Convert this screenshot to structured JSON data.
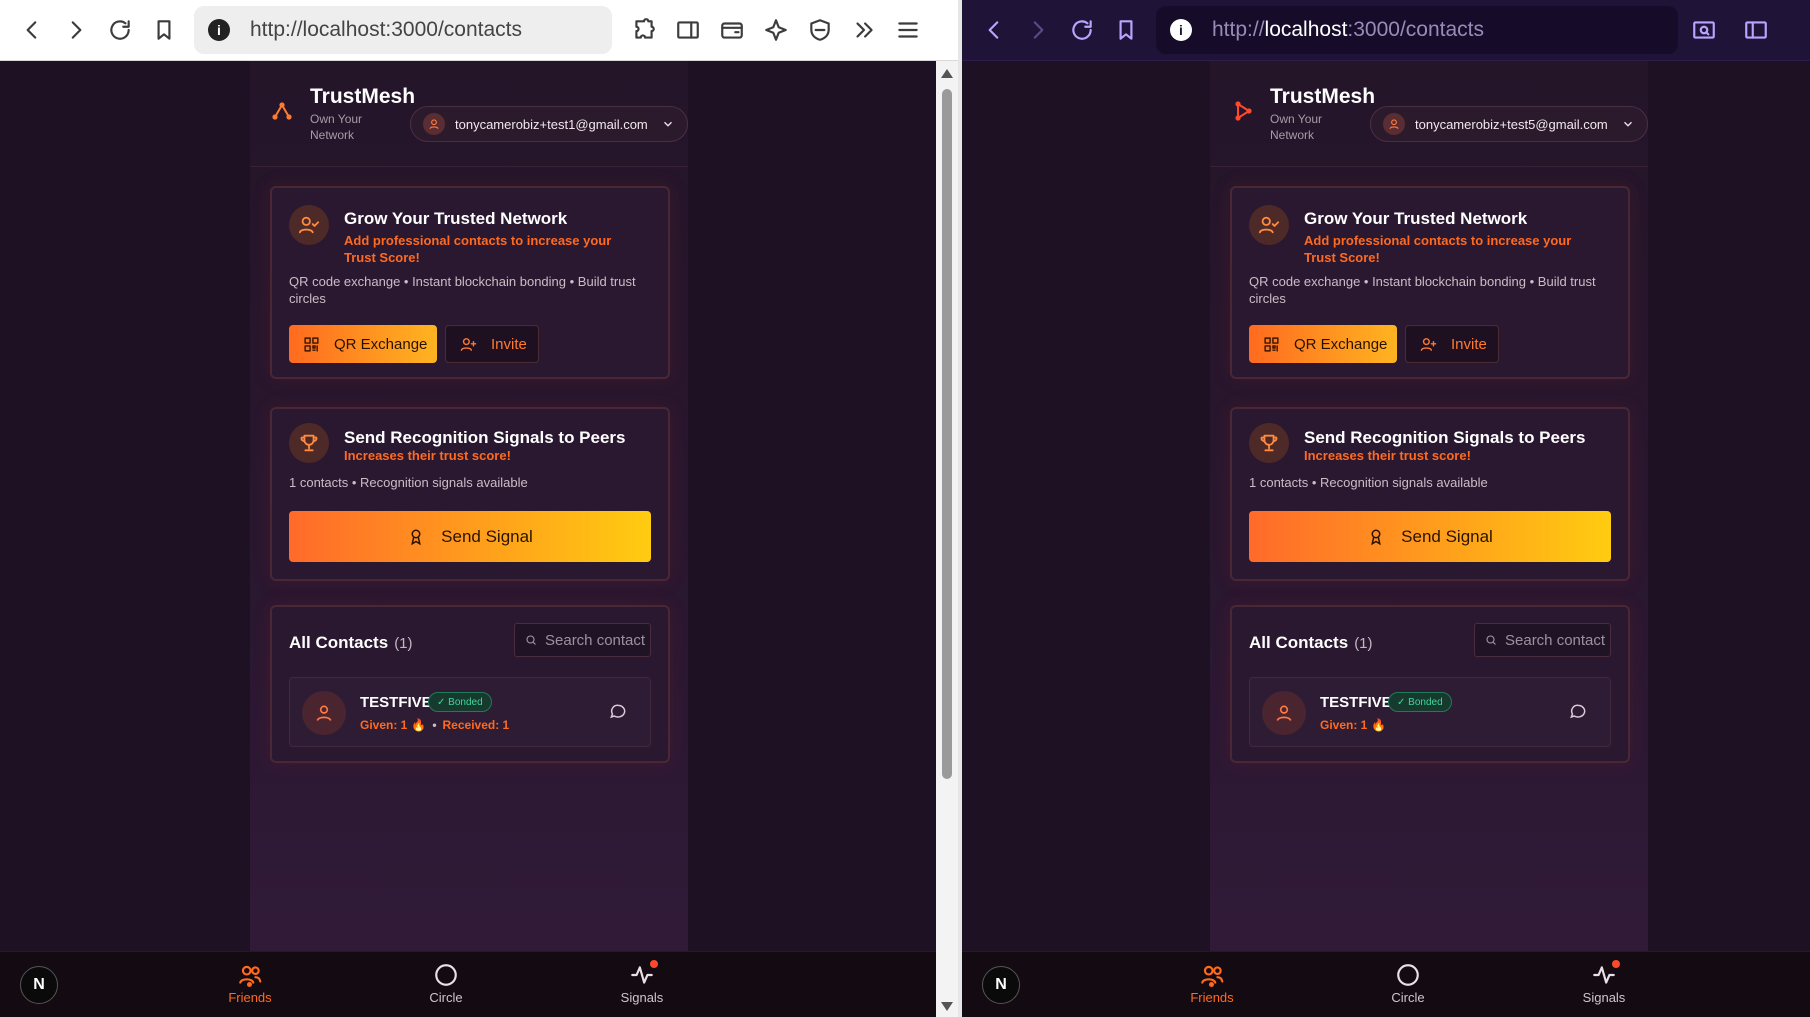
{
  "browsers": [
    {
      "url_prefix": "http://localhost:3000/contacts",
      "url_host": "",
      "url_rest": "",
      "app": {
        "brand_name": "TrustMesh",
        "brand_tag": "Own Your Network",
        "account_email": "tonycamerobiz+test1@gmail.com"
      },
      "grow": {
        "title": "Grow Your Trusted Network",
        "subtitle": "Add professional contacts to increase your Trust Score!",
        "meta": "QR code exchange • Instant blockchain bonding • Build trust circles",
        "qr_label": "QR Exchange",
        "invite_label": "Invite"
      },
      "signal": {
        "title": "Send Recognition Signals to Peers",
        "subtitle": "Increases their trust score!",
        "meta": "1 contacts • Recognition signals available",
        "button_label": "Send Signal"
      },
      "contacts": {
        "title": "All Contacts",
        "count": "(1)",
        "search_placeholder": "Search contacts",
        "items": [
          {
            "name": "TESTFIVE",
            "badge": "✓ Bonded",
            "given": "Given: 1",
            "received": "Received: 1"
          }
        ]
      },
      "nav": {
        "friends": "Friends",
        "circle": "Circle",
        "signals": "Signals",
        "n_badge": "N"
      }
    },
    {
      "url_prefix": "http://",
      "url_host": "localhost",
      "url_rest": ":3000/contacts",
      "app": {
        "brand_name": "TrustMesh",
        "brand_tag": "Own Your Network",
        "account_email": "tonycamerobiz+test5@gmail.com"
      },
      "grow": {
        "title": "Grow Your Trusted Network",
        "subtitle": "Add professional contacts to increase your Trust Score!",
        "meta": "QR code exchange • Instant blockchain bonding • Build trust circles",
        "qr_label": "QR Exchange",
        "invite_label": "Invite"
      },
      "signal": {
        "title": "Send Recognition Signals to Peers",
        "subtitle": "Increases their trust score!",
        "meta": "1 contacts • Recognition signals available",
        "button_label": "Send Signal"
      },
      "contacts": {
        "title": "All Contacts",
        "count": "(1)",
        "search_placeholder": "Search contacts",
        "items": [
          {
            "name": "TESTFIVE",
            "badge": "✓ Bonded",
            "given": "Given: 1"
          }
        ]
      },
      "nav": {
        "friends": "Friends",
        "circle": "Circle",
        "signals": "Signals",
        "n_badge": "N"
      }
    }
  ],
  "colors": {
    "accent_orange": "#ff6a1f",
    "accent_yellow": "#ffcc10",
    "bonded_green": "#3fd69a",
    "page_bg": "#1f1124"
  },
  "icons": {
    "back": "back-arrow-icon",
    "forward": "forward-arrow-icon",
    "reload": "reload-icon",
    "bookmark": "bookmark-icon",
    "extensions": "puzzle-icon",
    "sidebar": "sidebar-icon",
    "wallet": "wallet-icon",
    "ai": "sparkle-icon",
    "shield": "shield-icon",
    "more": "double-chevron-icon",
    "menu": "hamburger-icon"
  }
}
